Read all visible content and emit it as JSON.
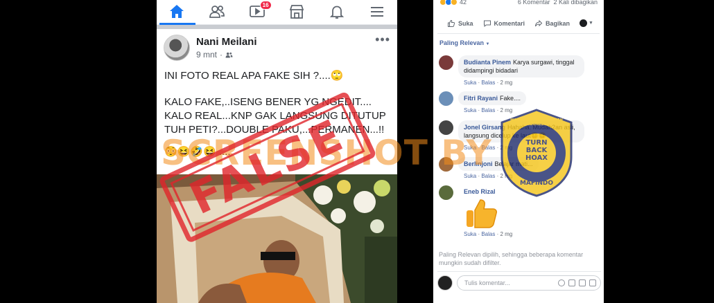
{
  "nav": {
    "items": [
      "home",
      "friends",
      "watch",
      "marketplace",
      "notifications",
      "menu"
    ],
    "watch_badge": "16"
  },
  "post": {
    "author": "Nani Meilani",
    "time": "9 mnt",
    "line1": "INI FOTO REAL APA FAKE SIH ?....🙄",
    "line2a": "KALO FAKE,..ISENG BENER YG NGEDIT....",
    "line2b": "KALO REAL...KNP GAK LANGSUNG DITUTUP",
    "line2c": "TUH PETI?...DOUBLE PAKU,...PERMANEN...!!",
    "line3": "😳😆🤣😆 ...."
  },
  "stats": {
    "reactions": "42",
    "comments": "6 Komentar",
    "shares": "2 Kali dibagikan"
  },
  "actions": {
    "like": "Suka",
    "comment": "Komentari",
    "share": "Bagikan"
  },
  "sort_label": "Paling Relevan",
  "comments": [
    {
      "name": "Budianta Pinem",
      "text": "Karya surgawi, tinggal didampingi bidadari",
      "like": "Suka",
      "reply": "Balas",
      "time": "2 mg"
    },
    {
      "name": "Fitri Rayani",
      "text": "Fake....",
      "like": "Suka",
      "reply": "Balas",
      "time": "2 mg"
    },
    {
      "name": "Jonel Girsang",
      "text": "Hahaha. Mudah2an asli, langsung dicelup ke laut😆😆",
      "like": "Suka",
      "reply": "Balas",
      "time": "2 mg"
    },
    {
      "name": "Berlinjoni",
      "text": "Belajar mati...",
      "like": "Suka",
      "reply": "Balas",
      "time": "2 mg"
    },
    {
      "name": "Eneb Rizal",
      "text": "",
      "like": "Suka",
      "reply": "Balas",
      "time": "2 mg"
    }
  ],
  "filter_note": "Paling Relevan dipilih, sehingga beberapa komentar mungkin sudah difilter.",
  "composer_placeholder": "Tulis komentar...",
  "watermark": {
    "screenshot_text": "SCREENSHOT BY",
    "stamp_text": "FALSE",
    "logo_line1": "TURN",
    "logo_line2": "BACK",
    "logo_line3": "HOAX",
    "logo_ring_top": "MASYARAKAT ANTI FITNAH INDONESIA",
    "logo_ring_bottom": "MAFINDO"
  },
  "colors": {
    "accent": "#1877f2",
    "link": "#385898",
    "stamp_red": "#e0242b",
    "watermark_orange": "#f28c1c"
  }
}
